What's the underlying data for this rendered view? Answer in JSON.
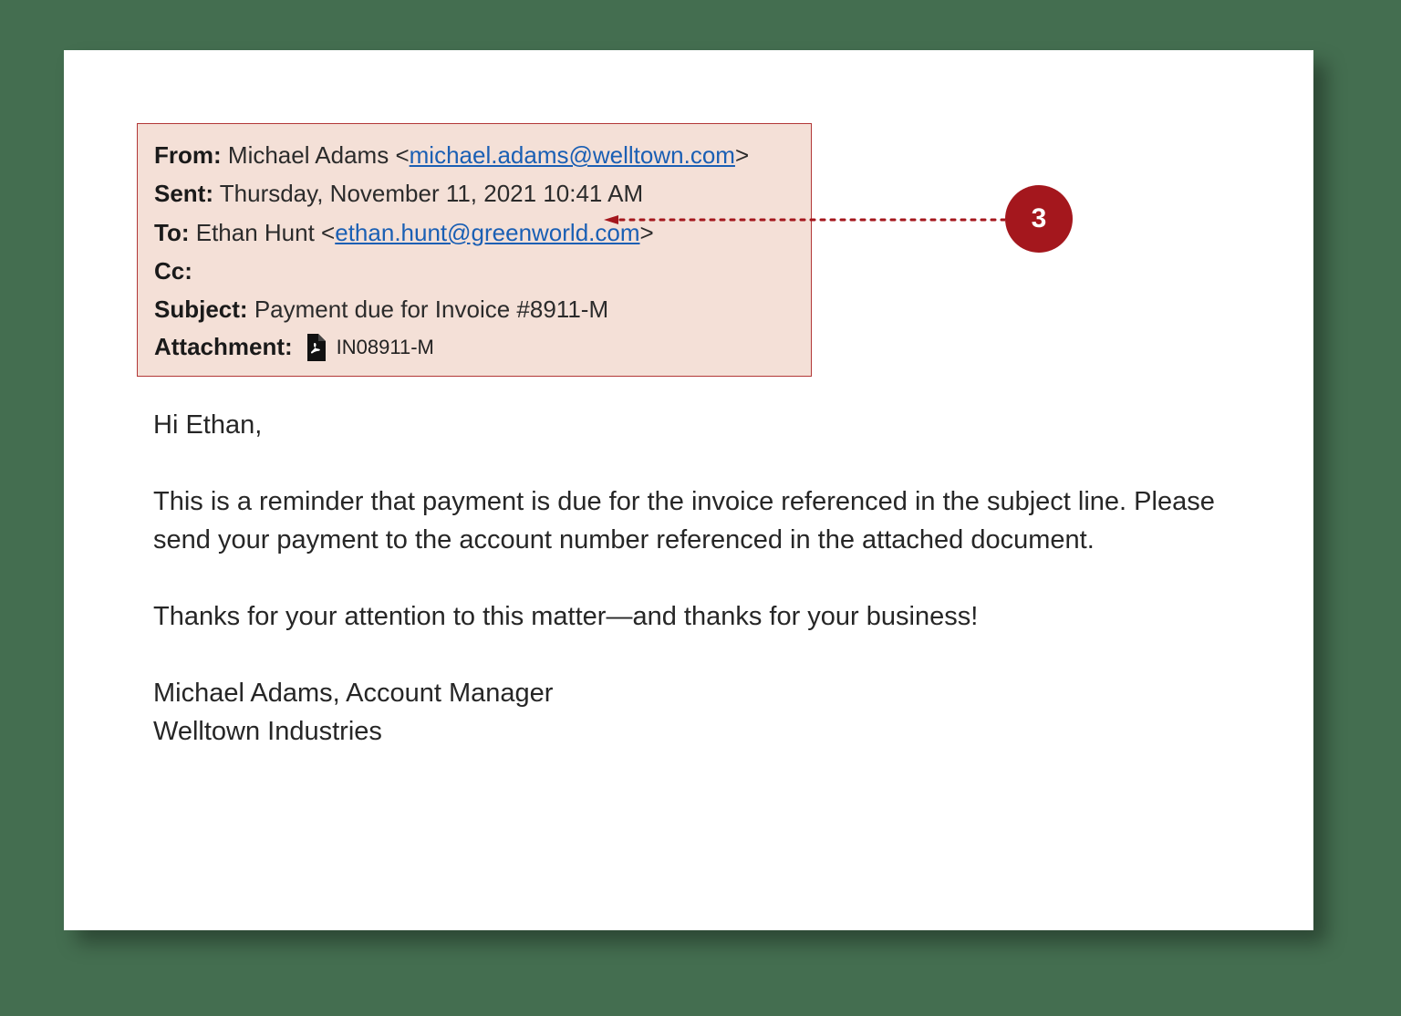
{
  "callout": {
    "number": "3"
  },
  "header": {
    "from_label": "From:",
    "from_name": "Michael Adams",
    "from_email": "michael.adams@welltown.com",
    "sent_label": "Sent:",
    "sent_value": "Thursday, November 11, 2021 10:41 AM",
    "to_label": "To:",
    "to_name": "Ethan Hunt",
    "to_email": "ethan.hunt@greenworld.com",
    "cc_label": "Cc:",
    "cc_value": "",
    "subject_label": "Subject:",
    "subject_value": "Payment due for Invoice #8911-M",
    "attachment_label": "Attachment:",
    "attachment_name": "IN08911-M"
  },
  "body": {
    "greeting": "Hi Ethan,",
    "p1": "This is a reminder that payment is due for the invoice referenced in the subject line. Please send your payment to the account number referenced in the attached document.",
    "p2": "Thanks for your attention to this matter—and thanks for your business!",
    "sig_line1": "Michael Adams, Account Manager",
    "sig_line2": "Welltown Industries"
  }
}
